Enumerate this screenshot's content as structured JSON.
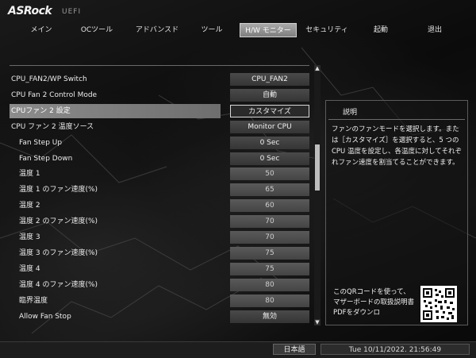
{
  "brand": {
    "logo": "ASRock",
    "subtitle": "UEFI"
  },
  "nav": {
    "tabs": [
      {
        "label": "メイン",
        "active": false
      },
      {
        "label": "OCツール",
        "active": false
      },
      {
        "label": "アドバンスド",
        "active": false
      },
      {
        "label": "ツール",
        "active": false
      },
      {
        "label": "H/W モニター",
        "active": true
      },
      {
        "label": "セキュリティ",
        "active": false
      },
      {
        "label": "起動",
        "active": false
      },
      {
        "label": "退出",
        "active": false
      }
    ]
  },
  "settings": [
    {
      "label": "CPU_FAN2/WP Switch",
      "value": "CPU_FAN2",
      "kind": "option",
      "indent": false
    },
    {
      "label": "CPU Fan 2 Control Mode",
      "value": "自動",
      "kind": "option",
      "indent": false
    },
    {
      "label": "CPUファン 2 設定",
      "value": "カスタマイズ",
      "kind": "option",
      "indent": false,
      "selected": true
    },
    {
      "label": "CPU ファン 2 温度ソース",
      "value": "Monitor CPU",
      "kind": "option",
      "indent": false
    },
    {
      "label": "Fan Step Up",
      "value": "0 Sec",
      "kind": "option",
      "indent": true
    },
    {
      "label": "Fan Step Down",
      "value": "0 Sec",
      "kind": "option",
      "indent": true
    },
    {
      "label": "温度 1",
      "value": "50",
      "kind": "number",
      "indent": true
    },
    {
      "label": "温度 1 のファン速度(%)",
      "value": "65",
      "kind": "number",
      "indent": true
    },
    {
      "label": "温度 2",
      "value": "60",
      "kind": "number",
      "indent": true
    },
    {
      "label": "温度 2 のファン速度(%)",
      "value": "70",
      "kind": "number",
      "indent": true
    },
    {
      "label": "温度 3",
      "value": "70",
      "kind": "number",
      "indent": true
    },
    {
      "label": "温度 3 のファン速度(%)",
      "value": "75",
      "kind": "number",
      "indent": true
    },
    {
      "label": "温度 4",
      "value": "75",
      "kind": "number",
      "indent": true
    },
    {
      "label": "温度 4 のファン速度(%)",
      "value": "80",
      "kind": "number",
      "indent": true
    },
    {
      "label": "臨界温度",
      "value": "80",
      "kind": "number",
      "indent": true
    },
    {
      "label": "Allow Fan Stop",
      "value": "無効",
      "kind": "option",
      "indent": true
    }
  ],
  "description": {
    "title": "説明",
    "text": "ファンのファンモードを選択します。または［カスタマイズ］を選択すると、5 つの CPU 温度を設定し、各温度に対してそれぞれファン速度を割当てることができます。",
    "qr_text": "このQRコードを使って、マザーボードの取扱説明書PDFをダウンロ"
  },
  "footer": {
    "language": "日本語",
    "datetime": "Tue 10/11/2022. 21:56:49"
  }
}
